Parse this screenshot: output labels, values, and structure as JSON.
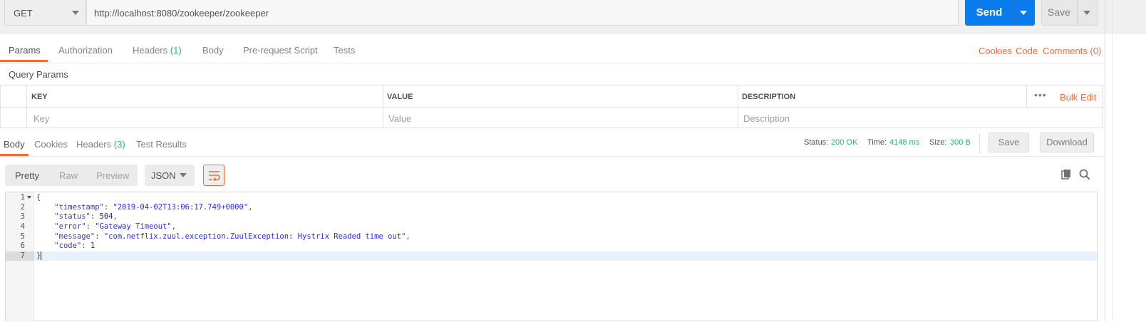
{
  "request": {
    "method": "GET",
    "url": "http://localhost:8080/zookeeper/zookeeper",
    "send_label": "Send",
    "save_label": "Save"
  },
  "request_tabs": [
    {
      "label": "Params",
      "count": ""
    },
    {
      "label": "Authorization",
      "count": ""
    },
    {
      "label": "Headers",
      "count": "(1)"
    },
    {
      "label": "Body",
      "count": ""
    },
    {
      "label": "Pre-request Script",
      "count": ""
    },
    {
      "label": "Tests",
      "count": ""
    }
  ],
  "request_links": {
    "cookies": "Cookies",
    "code": "Code",
    "comments": "Comments (0)"
  },
  "query_params": {
    "title": "Query Params",
    "columns": {
      "key": "KEY",
      "value": "VALUE",
      "description": "DESCRIPTION"
    },
    "bulk_edit": "Bulk Edit",
    "placeholders": {
      "key": "Key",
      "value": "Value",
      "description": "Description"
    }
  },
  "response_tabs": [
    {
      "label": "Body",
      "count": ""
    },
    {
      "label": "Cookies",
      "count": ""
    },
    {
      "label": "Headers",
      "count": "(3)"
    },
    {
      "label": "Test Results",
      "count": ""
    }
  ],
  "response_status": {
    "status_label": "Status:",
    "status_value": "200 OK",
    "time_label": "Time:",
    "time_value": "4148 ms",
    "size_label": "Size:",
    "size_value": "300 B",
    "save_label": "Save",
    "download_label": "Download"
  },
  "body_view": {
    "modes": [
      "Pretty",
      "Raw",
      "Preview"
    ],
    "active_mode": "Pretty",
    "format": "JSON"
  },
  "response_body": {
    "line_numbers": [
      "1",
      "2",
      "3",
      "4",
      "5",
      "6",
      "7"
    ],
    "open": "{",
    "close": "}",
    "fields": [
      {
        "key": "\"timestamp\"",
        "value": "\"2019-04-02T13:06:17.749+0000\"",
        "tail": ","
      },
      {
        "key": "\"status\"",
        "value": "504",
        "tail": ","
      },
      {
        "key": "\"error\"",
        "value": "\"Gateway Timeout\"",
        "tail": ","
      },
      {
        "key": "\"message\"",
        "value": "\"com.netflix.zuul.exception.ZuulException: Hystrix Readed time out\"",
        "tail": ","
      },
      {
        "key": "\"code\"",
        "value": "1",
        "tail": ""
      }
    ]
  },
  "icons": {
    "copy": "copy-icon",
    "search": "search-icon",
    "wrap": "wrap-lines-icon",
    "more": "more-icon"
  },
  "colors": {
    "send": "#097bed",
    "accent": "#f26b3a",
    "success": "#26b47f"
  }
}
